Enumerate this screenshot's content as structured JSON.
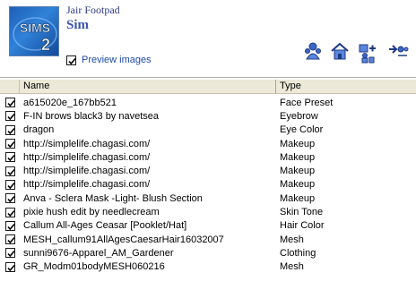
{
  "header": {
    "logo_text": "SIMS 2",
    "creator": "Jair Footpad",
    "package_type": "Sim",
    "preview_label": "Preview images",
    "preview_checked": true
  },
  "toolbar": [
    {
      "icon": "sim-icon",
      "color": "#3a67c6"
    },
    {
      "icon": "home-icon",
      "color": "#3a67c6"
    },
    {
      "icon": "add-sim-icon",
      "color": "#3a67c6"
    },
    {
      "icon": "transfer-icon",
      "color": "#3a67c6"
    }
  ],
  "table": {
    "columns": [
      "Name",
      "Type"
    ],
    "rows": [
      {
        "checked": true,
        "name": "a615020e_167bb521",
        "type": "Face Preset"
      },
      {
        "checked": true,
        "name": "F-IN brows black3 by navetsea",
        "type": "Eyebrow"
      },
      {
        "checked": true,
        "name": "dragon",
        "type": "Eye Color"
      },
      {
        "checked": true,
        "name": "http://simplelife.chagasi.com/",
        "type": "Makeup"
      },
      {
        "checked": true,
        "name": "http://simplelife.chagasi.com/",
        "type": "Makeup"
      },
      {
        "checked": true,
        "name": "http://simplelife.chagasi.com/",
        "type": "Makeup"
      },
      {
        "checked": true,
        "name": "http://simplelife.chagasi.com/",
        "type": "Makeup"
      },
      {
        "checked": true,
        "name": "Anva - Sclera Mask -Light- Blush Section",
        "type": "Makeup"
      },
      {
        "checked": true,
        "name": "pixie hush edit by needlecream",
        "type": "Skin Tone"
      },
      {
        "checked": true,
        "name": "Callum All-Ages Ceasar [Pooklet/Hat]",
        "type": "Hair Color"
      },
      {
        "checked": true,
        "name": "MESH_callum91AllAgesCaesarHair16032007",
        "type": "Mesh"
      },
      {
        "checked": true,
        "name": "sunni9676-Apparel_AM_Gardener",
        "type": "Clothing"
      },
      {
        "checked": true,
        "name": "GR_Modm01bodyMESH060216",
        "type": "Mesh"
      }
    ]
  }
}
